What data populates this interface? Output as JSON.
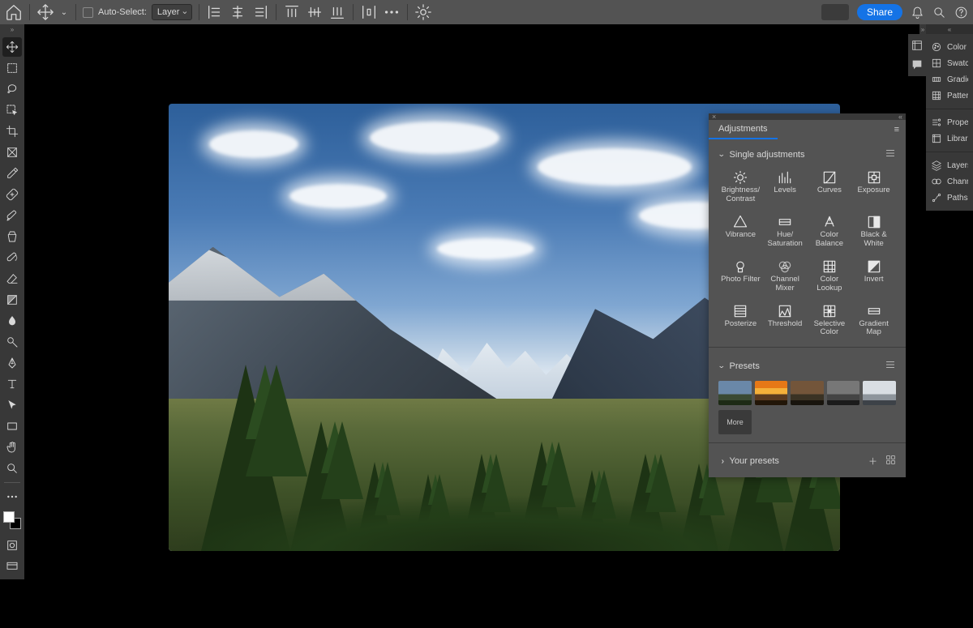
{
  "optionsBar": {
    "autoSelectLabel": "Auto-Select:",
    "select": "Layer",
    "shareLabel": "Share"
  },
  "tools": [
    "move",
    "marquee",
    "lasso",
    "object-select",
    "crop",
    "frame",
    "eyedropper",
    "heal",
    "brush",
    "clone",
    "history-brush",
    "eraser",
    "gradient",
    "blur",
    "dodge",
    "pen",
    "type",
    "path-select",
    "rectangle",
    "hand",
    "zoom"
  ],
  "adjPanel": {
    "title": "Adjustments",
    "section1": "Single adjustments",
    "section2": "Presets",
    "section3": "Your presets",
    "moreLabel": "More",
    "items": [
      "Brightness/\nContrast",
      "Levels",
      "Curves",
      "Exposure",
      "Vibrance",
      "Hue/\nSaturation",
      "Color\nBalance",
      "Black &\nWhite",
      "Photo Filter",
      "Channel\nMixer",
      "Color\nLookup",
      "Invert",
      "Posterize",
      "Threshold",
      "Selective\nColor",
      "Gradient\nMap"
    ]
  },
  "sidePanels": {
    "group1": [
      "Color",
      "Swatches",
      "Gradients",
      "Patterns"
    ],
    "group2": [
      "Properties",
      "Libraries"
    ],
    "group3": [
      "Layers",
      "Channels",
      "Paths"
    ]
  }
}
